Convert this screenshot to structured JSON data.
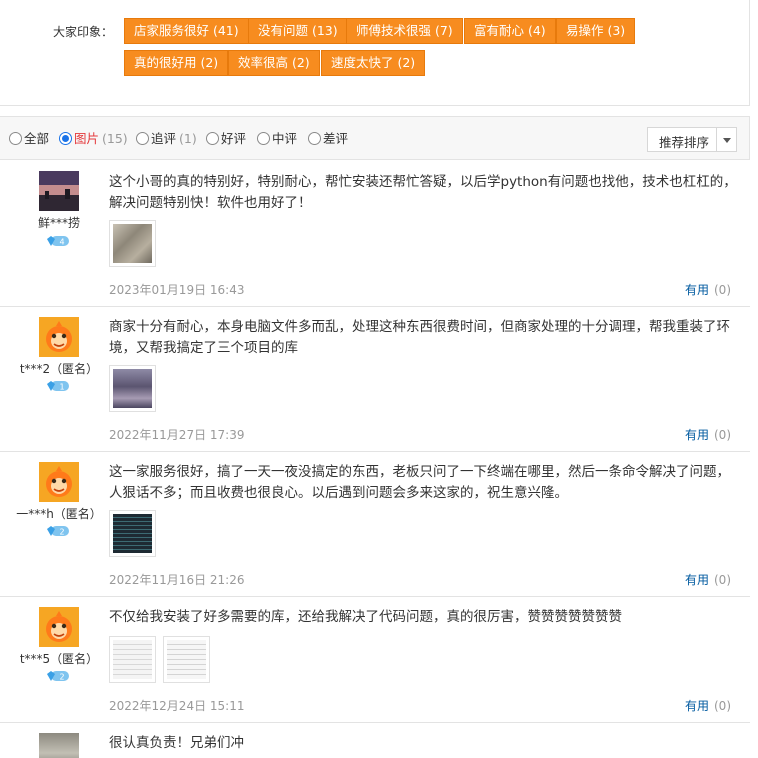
{
  "impressions": {
    "label": "大家印象：",
    "tags": [
      "店家服务很好 (41)",
      "没有问题 (13)",
      "师傅技术很强 (7)",
      "富有耐心 (4)",
      "易操作 (3)",
      "真的很好用 (2)",
      "效率很高 (2)",
      "速度太快了 (2)"
    ]
  },
  "filters": [
    {
      "label": "全部",
      "count": "",
      "selected": false
    },
    {
      "label": "图片",
      "count": "(15)",
      "selected": true
    },
    {
      "label": "追评",
      "count": "(1)",
      "selected": false
    },
    {
      "label": "好评",
      "count": "",
      "selected": false
    },
    {
      "label": "中评",
      "count": "",
      "selected": false
    },
    {
      "label": "差评",
      "count": "",
      "selected": false
    }
  ],
  "sort": {
    "label": "推荐排序",
    "icon": "caret-down-icon"
  },
  "reviews": [
    {
      "username": "鲜***捞",
      "avatar": "photo-avatar",
      "badge_level": "4",
      "content": "这个小哥的真的特别好，特别耐心，帮忙安装还帮忙答疑，以后学python有问题也找他，技术也杠杠的，解决问题特别快！软件也用好了！",
      "date": "2023年01月19日 16:43",
      "useful_label": "有用",
      "useful_count": "(0)"
    },
    {
      "username": "t***2（匿名）",
      "avatar": "mascot-avatar",
      "badge_level": "1",
      "content": "商家十分有耐心，本身电脑文件多而乱，处理这种东西很费时间，但商家处理的十分调理，帮我重装了环境，又帮我搞定了三个项目的库",
      "date": "2022年11月27日 17:39",
      "useful_label": "有用",
      "useful_count": "(0)"
    },
    {
      "username": "一***h（匿名）",
      "avatar": "mascot-avatar",
      "badge_level": "2",
      "content": "这一家服务很好，搞了一天一夜没搞定的东西，老板只问了一下终端在哪里，然后一条命令解决了问题，人狠话不多；而且收费也很良心。以后遇到问题会多来这家的，祝生意兴隆。",
      "date": "2022年11月16日 21:26",
      "useful_label": "有用",
      "useful_count": "(0)"
    },
    {
      "username": "t***5（匿名）",
      "avatar": "mascot-avatar",
      "badge_level": "2",
      "content": "不仅给我安装了好多需要的库，还给我解决了代码问题，真的很厉害，赞赞赞赞赞赞赞",
      "date": "2022年12月24日 15:11",
      "useful_label": "有用",
      "useful_count": "(0)"
    },
    {
      "username": "",
      "avatar": "photo-avatar",
      "badge_level": "",
      "content": "很认真负责！兄弟们冲",
      "date": "",
      "useful_label": "",
      "useful_count": ""
    }
  ]
}
